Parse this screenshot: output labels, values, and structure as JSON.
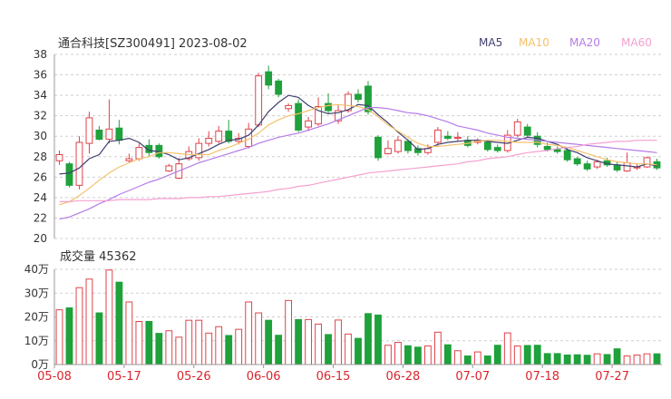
{
  "header": {
    "title": "通合科技[SZ300491] 2023-08-02"
  },
  "legend": [
    {
      "label": "MA5",
      "color": "#3f3f6f"
    },
    {
      "label": "MA10",
      "color": "#f5c16c"
    },
    {
      "label": "MA20",
      "color": "#b57be8"
    },
    {
      "label": "MA60",
      "color": "#f5a0d0"
    }
  ],
  "volume_panel": {
    "title": "成交量 45362"
  },
  "colors": {
    "up": "#e0434a",
    "down": "#1fa13b",
    "grid": "#cfcfcf",
    "axis": "#333333",
    "date_label": "#d9262c"
  },
  "chart_data": [
    {
      "type": "candlestick",
      "title": "通合科技[SZ300491] 2023-08-02",
      "ylim": [
        20,
        38
      ],
      "yticks": [
        20,
        22,
        24,
        26,
        28,
        30,
        32,
        34,
        36,
        38
      ],
      "x_tick_labels": [
        "05-08",
        "05-17",
        "05-26",
        "06-06",
        "06-15",
        "06-28",
        "07-07",
        "07-18",
        "07-27"
      ],
      "x_tick_index": [
        0,
        7,
        14,
        21,
        28,
        35,
        42,
        49,
        56
      ],
      "candles": [
        [
          27.6,
          28.2,
          27.2,
          28.6
        ],
        [
          27.3,
          25.2,
          25.0,
          27.5
        ],
        [
          25.2,
          29.4,
          24.8,
          30.0
        ],
        [
          29.3,
          31.8,
          28.3,
          32.4
        ],
        [
          30.6,
          29.7,
          29.6,
          31.0
        ],
        [
          29.7,
          30.7,
          29.3,
          33.6
        ],
        [
          30.8,
          29.6,
          29.2,
          31.6
        ],
        [
          27.6,
          27.8,
          27.4,
          28.3
        ],
        [
          27.8,
          28.9,
          27.6,
          29.3
        ],
        [
          29.1,
          28.4,
          28.0,
          29.7
        ],
        [
          29.1,
          28.0,
          27.8,
          29.3
        ],
        [
          26.6,
          27.1,
          26.5,
          27.3
        ],
        [
          25.9,
          27.3,
          25.8,
          27.9
        ],
        [
          27.8,
          28.5,
          27.6,
          29.0
        ],
        [
          27.9,
          29.3,
          27.6,
          29.8
        ],
        [
          29.3,
          29.8,
          29.0,
          30.5
        ],
        [
          29.5,
          30.5,
          29.3,
          31.0
        ],
        [
          30.5,
          29.5,
          29.3,
          31.6
        ],
        [
          29.5,
          29.8,
          29.2,
          30.3
        ],
        [
          29.0,
          30.7,
          28.8,
          31.3
        ],
        [
          31.1,
          35.9,
          30.9,
          36.2
        ],
        [
          36.3,
          35.0,
          34.6,
          36.9
        ],
        [
          35.4,
          34.1,
          33.8,
          35.6
        ],
        [
          32.7,
          33.0,
          32.4,
          33.2
        ],
        [
          33.2,
          30.6,
          30.4,
          33.6
        ],
        [
          30.9,
          31.5,
          30.5,
          31.9
        ],
        [
          31.2,
          32.9,
          31.0,
          33.8
        ],
        [
          33.2,
          32.5,
          32.2,
          34.2
        ],
        [
          31.5,
          32.5,
          31.2,
          33.1
        ],
        [
          32.5,
          34.1,
          32.3,
          34.4
        ],
        [
          34.1,
          33.6,
          33.3,
          34.6
        ],
        [
          34.9,
          32.4,
          32.1,
          35.4
        ],
        [
          29.9,
          27.9,
          27.6,
          30.1
        ],
        [
          28.3,
          28.8,
          28.2,
          29.6
        ],
        [
          28.5,
          29.6,
          28.3,
          30.0
        ],
        [
          29.5,
          28.6,
          28.3,
          29.7
        ],
        [
          28.8,
          28.4,
          28.1,
          29.1
        ],
        [
          28.4,
          28.8,
          28.2,
          29.2
        ],
        [
          29.4,
          30.6,
          29.0,
          30.9
        ],
        [
          30.0,
          29.8,
          29.6,
          30.5
        ],
        [
          29.8,
          29.9,
          29.5,
          30.4
        ],
        [
          29.6,
          29.1,
          28.9,
          30.0
        ],
        [
          29.4,
          29.6,
          29.2,
          29.8
        ],
        [
          29.4,
          28.7,
          28.5,
          29.6
        ],
        [
          28.9,
          28.6,
          28.4,
          29.2
        ],
        [
          28.6,
          30.1,
          28.4,
          30.6
        ],
        [
          30.1,
          31.4,
          29.9,
          31.7
        ],
        [
          30.9,
          30.1,
          29.9,
          31.2
        ],
        [
          30.0,
          29.2,
          28.9,
          30.4
        ],
        [
          29.0,
          28.7,
          28.5,
          29.4
        ],
        [
          28.7,
          28.5,
          28.3,
          29.0
        ],
        [
          28.6,
          27.7,
          27.5,
          28.9
        ],
        [
          27.8,
          27.3,
          27.1,
          28.0
        ],
        [
          27.3,
          26.8,
          26.6,
          27.6
        ],
        [
          27.0,
          27.5,
          26.8,
          27.7
        ],
        [
          27.6,
          27.2,
          27.0,
          27.9
        ],
        [
          27.2,
          26.7,
          26.5,
          27.5
        ],
        [
          26.6,
          27.4,
          26.5,
          28.4
        ],
        [
          26.9,
          27.0,
          26.7,
          27.3
        ],
        [
          27.0,
          27.9,
          26.9,
          28.0
        ],
        [
          27.5,
          26.9,
          26.7,
          27.8
        ]
      ],
      "ma": {
        "MA5": [
          26.3,
          26.4,
          26.9,
          27.8,
          28.2,
          29.5,
          29.6,
          29.8,
          29.4,
          28.6,
          28.5,
          28.2,
          27.7,
          27.9,
          28.3,
          28.7,
          29.2,
          29.6,
          29.7,
          30.1,
          31.1,
          32.4,
          33.3,
          34.0,
          33.8,
          33.0,
          32.5,
          32.2,
          32.3,
          32.6,
          33.1,
          33.0,
          32.1,
          31.3,
          30.4,
          29.6,
          28.7,
          28.8,
          29.2,
          29.4,
          29.5,
          29.6,
          29.6,
          29.5,
          29.4,
          29.3,
          29.6,
          29.9,
          29.8,
          29.5,
          29.2,
          28.7,
          28.4,
          27.9,
          27.6,
          27.3,
          27.2,
          27.1,
          27.0,
          27.3,
          27.1
        ],
        "MA10": [
          23.3,
          23.6,
          24.2,
          24.9,
          25.7,
          26.4,
          27.0,
          27.4,
          27.8,
          28.0,
          28.4,
          28.4,
          28.3,
          28.2,
          28.2,
          28.2,
          28.6,
          28.9,
          29.3,
          29.7,
          30.3,
          31.1,
          31.6,
          32.0,
          32.2,
          32.5,
          32.8,
          33.0,
          33.1,
          33.0,
          32.9,
          32.6,
          31.9,
          31.1,
          30.5,
          29.9,
          29.3,
          29.0,
          29.0,
          29.1,
          29.2,
          29.3,
          29.5,
          29.6,
          29.6,
          29.5,
          29.4,
          29.4,
          29.4,
          29.2,
          29.1,
          28.9,
          28.6,
          28.3,
          28.0,
          27.7,
          27.5,
          27.4,
          27.3,
          27.3,
          27.2
        ],
        "MA20": [
          21.9,
          22.1,
          22.5,
          22.9,
          23.4,
          23.8,
          24.3,
          24.7,
          25.1,
          25.5,
          25.8,
          26.2,
          26.6,
          27.0,
          27.4,
          27.7,
          28.0,
          28.3,
          28.6,
          28.9,
          29.3,
          29.6,
          29.9,
          30.1,
          30.3,
          30.6,
          30.9,
          31.2,
          31.6,
          32.0,
          32.4,
          32.8,
          32.8,
          32.7,
          32.5,
          32.3,
          32.2,
          32.0,
          31.7,
          31.4,
          31.0,
          30.8,
          30.6,
          30.3,
          30.1,
          29.9,
          29.8,
          29.7,
          29.6,
          29.5,
          29.4,
          29.3,
          29.2,
          29.1,
          29.0,
          28.9,
          28.8,
          28.7,
          28.6,
          28.5,
          28.4
        ],
        "MA60": [
          23.6,
          23.6,
          23.7,
          23.7,
          23.7,
          23.7,
          23.8,
          23.8,
          23.8,
          23.8,
          23.9,
          23.9,
          23.9,
          24.0,
          24.0,
          24.1,
          24.1,
          24.2,
          24.3,
          24.4,
          24.5,
          24.6,
          24.8,
          24.9,
          25.1,
          25.2,
          25.4,
          25.6,
          25.8,
          26.0,
          26.2,
          26.4,
          26.5,
          26.6,
          26.7,
          26.8,
          26.9,
          27.0,
          27.1,
          27.2,
          27.3,
          27.5,
          27.6,
          27.8,
          27.9,
          28.0,
          28.2,
          28.4,
          28.5,
          28.6,
          28.8,
          28.9,
          29.0,
          29.2,
          29.3,
          29.4,
          29.5,
          29.5,
          29.6,
          29.6,
          29.6
        ]
      }
    },
    {
      "type": "bar",
      "title": "成交量 45362",
      "ylim": [
        0,
        40
      ],
      "yticks": [
        "0万",
        "10万",
        "20万",
        "30万",
        "40万"
      ],
      "unit": "万",
      "values": [
        23.0,
        23.8,
        32.3,
        35.9,
        21.7,
        39.7,
        34.6,
        26.3,
        18.1,
        18.1,
        13.1,
        14.2,
        11.5,
        18.6,
        18.6,
        13.2,
        15.9,
        12.2,
        14.8,
        26.3,
        21.7,
        18.6,
        12.3,
        26.9,
        18.9,
        18.9,
        17.0,
        12.6,
        18.7,
        12.8,
        11.0,
        21.4,
        20.8,
        8.1,
        9.3,
        7.9,
        7.3,
        7.8,
        13.6,
        8.3,
        5.8,
        3.6,
        5.3,
        3.6,
        8.1,
        13.3,
        7.8,
        8.0,
        8.1,
        4.6,
        4.6,
        4.0,
        4.1,
        3.9,
        4.5,
        4.2,
        6.6,
        3.6,
        4.0,
        4.5,
        4.5
      ]
    }
  ]
}
